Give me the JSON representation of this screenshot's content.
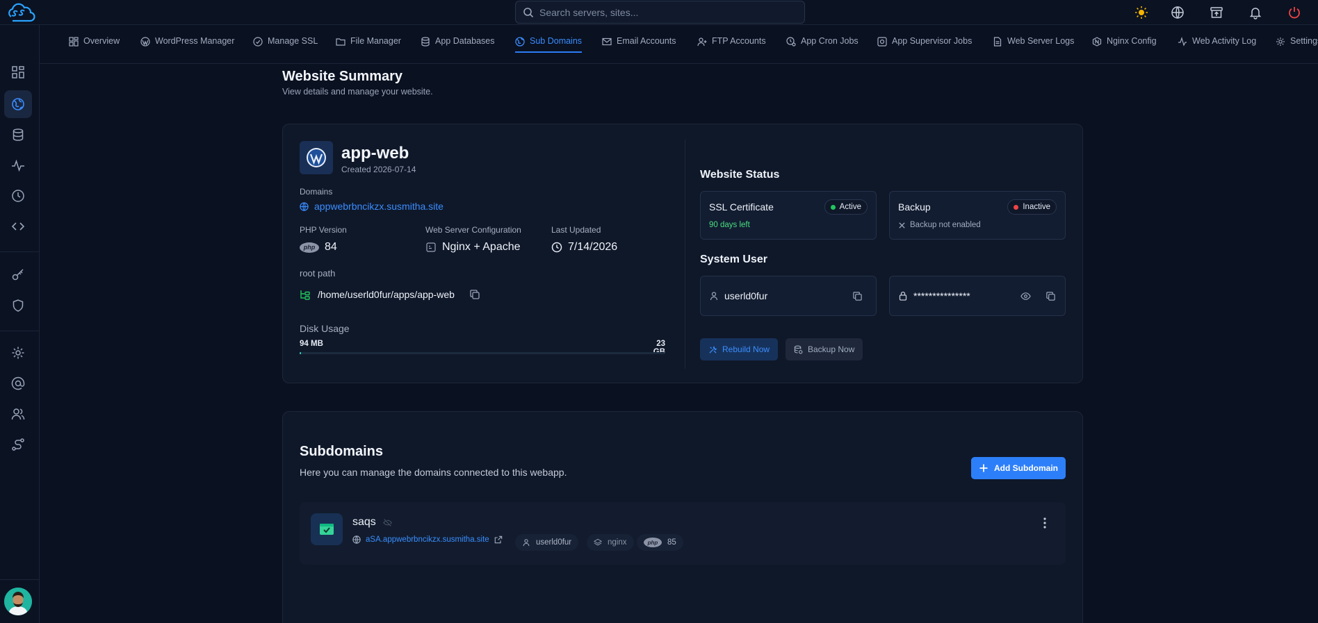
{
  "search": {
    "placeholder": "Search servers, sites..."
  },
  "tabs": [
    {
      "label": "Overview",
      "icon": "grid-icon"
    },
    {
      "label": "WordPress Manager",
      "icon": "wordpress-icon"
    },
    {
      "label": "Manage SSL",
      "icon": "ssl-icon"
    },
    {
      "label": "File Manager",
      "icon": "folder-icon"
    },
    {
      "label": "App Databases",
      "icon": "database-icon"
    },
    {
      "label": "Sub Domains",
      "icon": "globe-icon",
      "active": true
    },
    {
      "label": "Email Accounts",
      "icon": "mail-icon"
    },
    {
      "label": "FTP Accounts",
      "icon": "user-plus-icon"
    },
    {
      "label": "App Cron Jobs",
      "icon": "clock-cog-icon"
    },
    {
      "label": "App Supervisor Jobs",
      "icon": "cog-box-icon"
    },
    {
      "label": "Web Server Logs",
      "icon": "file-text-icon"
    },
    {
      "label": "Nginx Config",
      "icon": "nginx-icon"
    },
    {
      "label": "Web Activity Log",
      "icon": "activity-icon"
    },
    {
      "label": "Settings",
      "icon": "settings-icon"
    }
  ],
  "page": {
    "title": "Website Summary",
    "subtitle": "View details and manage your website."
  },
  "summary": {
    "app_name": "app-web",
    "created": "Created 2026-07-14",
    "domains_label": "Domains",
    "domain": "appwebrbncikzx.susmitha.site",
    "php_label": "PHP Version",
    "php_value": "84",
    "php_badge": "php",
    "webserver_label": "Web Server Configuration",
    "webserver_value": "Nginx + Apache",
    "updated_label": "Last Updated",
    "updated_value": "7/14/2026",
    "root_label": "root path",
    "root_value": "/home/userld0fur/apps/app-web",
    "disk_label": "Disk Usage",
    "disk_used": "94 MB",
    "disk_total": "23 GB",
    "disk_fraction": 0.004
  },
  "status": {
    "title": "Website Status",
    "ssl": {
      "name": "SSL Certificate",
      "state": "Active",
      "sub": "90 days left",
      "color": "#22c55e"
    },
    "backup": {
      "name": "Backup",
      "state": "Inactive",
      "sub": "Backup not enabled",
      "color": "#ef4444"
    },
    "system_user_title": "System User",
    "username": "userld0fur",
    "password_mask": "***************",
    "rebuild_label": "Rebuild Now",
    "backup_label": "Backup Now"
  },
  "subdomains": {
    "title": "Subdomains",
    "description": "Here you can manage the domains connected to this webapp.",
    "add_label": "Add Subdomain",
    "items": [
      {
        "name": "saqs",
        "url": "aSA.appwebrbncikzx.susmitha.site",
        "user": "userld0fur",
        "server": "nginx",
        "php_badge": "php",
        "php": "85"
      }
    ]
  },
  "colors": {
    "accent": "#2d7ff9",
    "active_tab": "#3a8dff",
    "teal": "#2dd4bf"
  }
}
